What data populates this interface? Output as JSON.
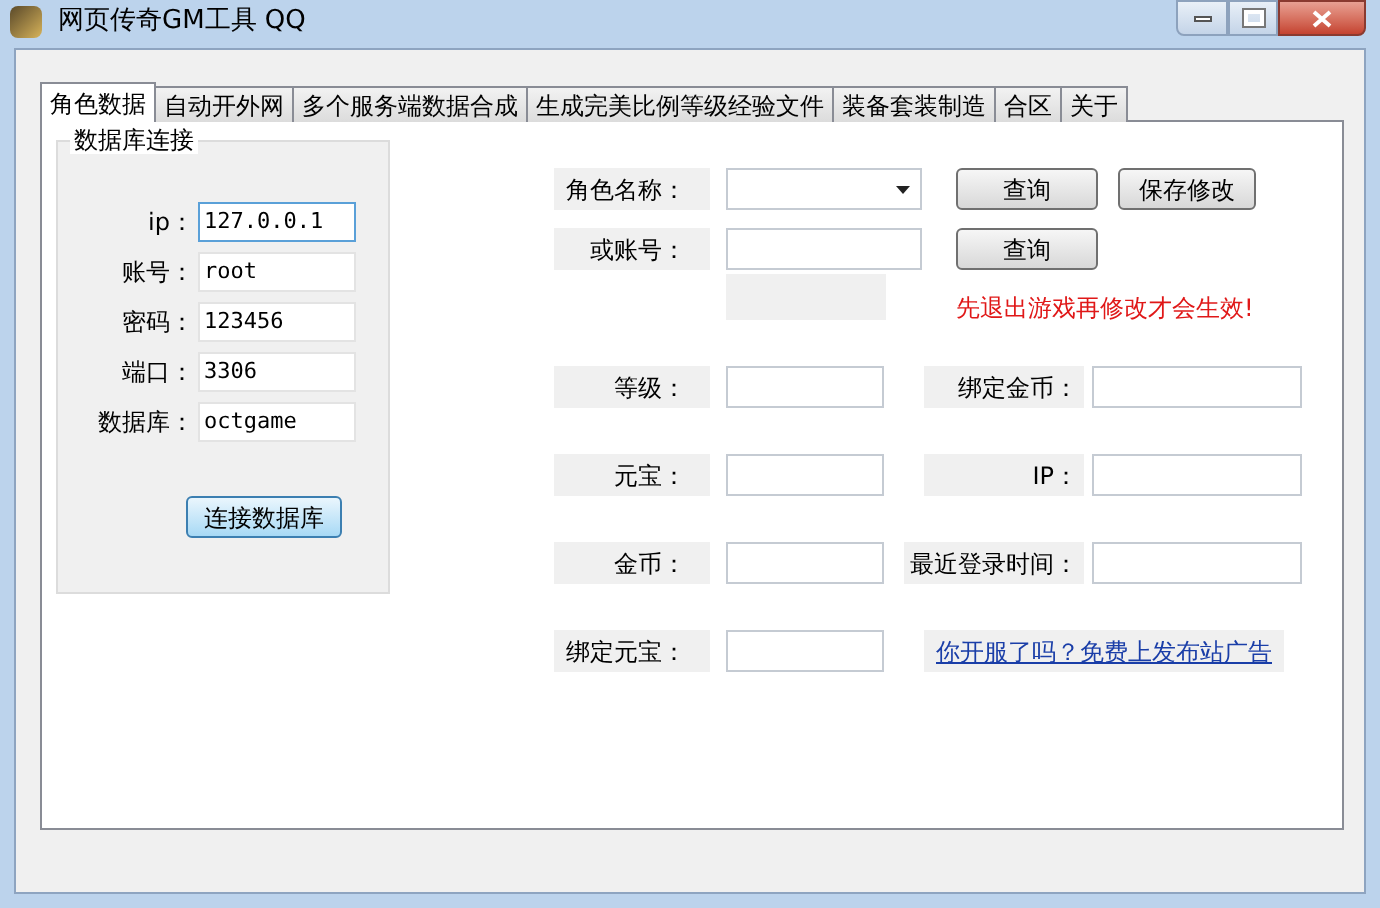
{
  "window": {
    "title": "网页传奇GM工具 QQ"
  },
  "tabs": [
    {
      "label": "角色数据",
      "selected": true
    },
    {
      "label": "自动开外网",
      "selected": false
    },
    {
      "label": "多个服务端数据合成",
      "selected": false
    },
    {
      "label": "生成完美比例等级经验文件",
      "selected": false
    },
    {
      "label": "装备套装制造",
      "selected": false
    },
    {
      "label": "合区",
      "selected": false
    },
    {
      "label": "关于",
      "selected": false
    }
  ],
  "db_group": {
    "title": "数据库连接",
    "fields": [
      {
        "label": "ip：",
        "value": "127.0.0.1",
        "focused": true
      },
      {
        "label": "账号：",
        "value": "root",
        "focused": false
      },
      {
        "label": "密码：",
        "value": "123456",
        "focused": false
      },
      {
        "label": "端口：",
        "value": "3306",
        "focused": false
      },
      {
        "label": "数据库：",
        "value": "octgame",
        "focused": false
      }
    ],
    "button": "连接数据库"
  },
  "character": {
    "name_label": "角色名称：",
    "query_button": "查询",
    "save_button": "保存修改",
    "account_label": "或账号：",
    "account_query_button": "查询",
    "notice": "先退出游戏再修改才会生效!",
    "fields": [
      {
        "label": "等级："
      },
      {
        "label": "绑定金币："
      },
      {
        "label": "元宝："
      },
      {
        "label": "IP："
      },
      {
        "label": "金币："
      },
      {
        "label": "最近登录时间："
      },
      {
        "label": "绑定元宝："
      }
    ],
    "ad_link": "你开服了吗？免费上发布站广告"
  }
}
